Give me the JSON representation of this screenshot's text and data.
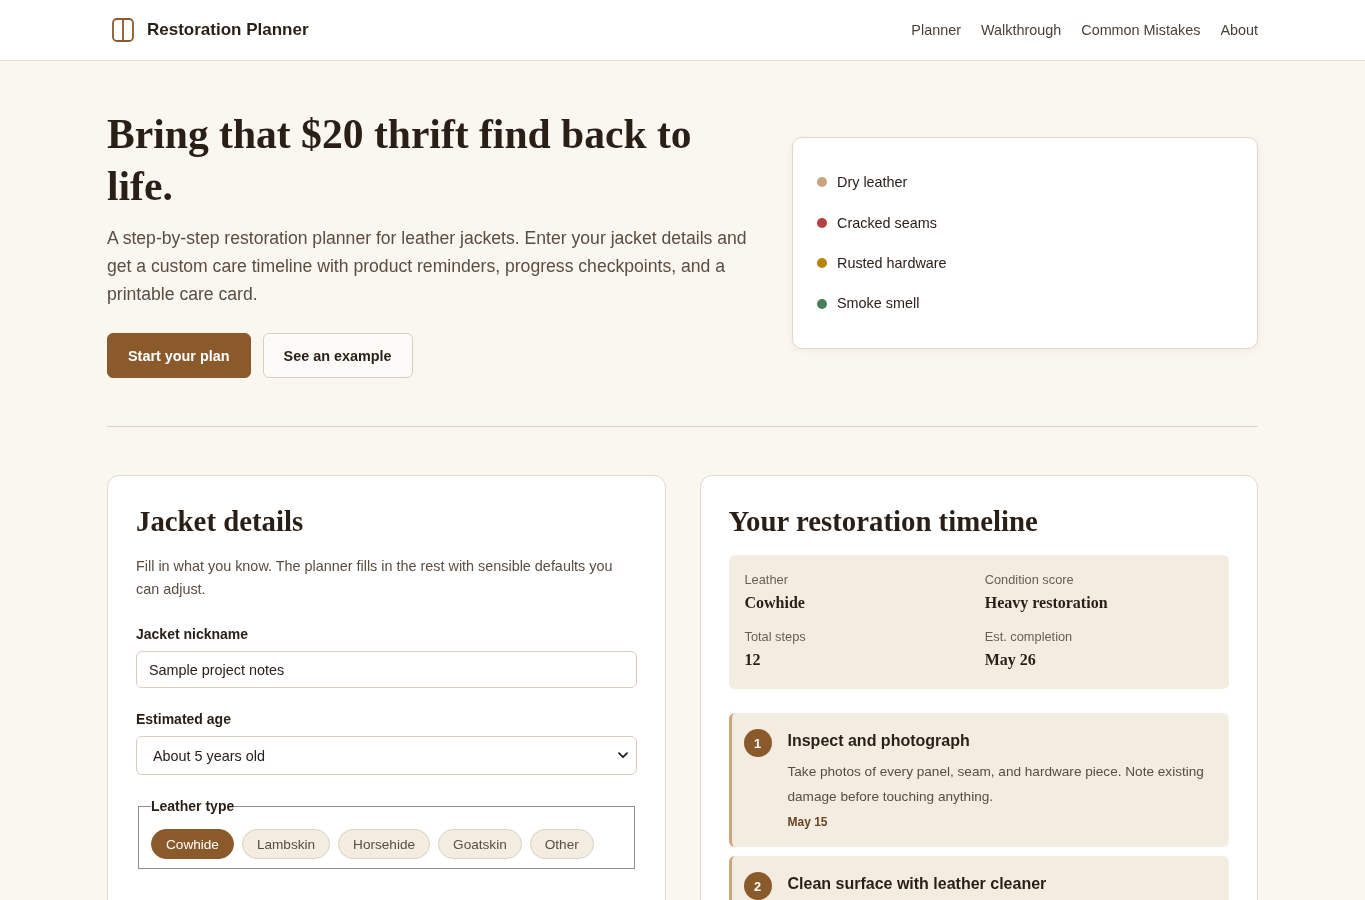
{
  "header": {
    "brand": "Restoration Planner",
    "nav": [
      {
        "label": "Planner"
      },
      {
        "label": "Walkthrough"
      },
      {
        "label": "Common Mistakes"
      },
      {
        "label": "About"
      }
    ]
  },
  "hero": {
    "title": "Bring that $20 thrift find back to life.",
    "description": "A step-by-step restoration planner for leather jackets. Enter your jacket details and get a custom care timeline with product reminders, progress checkpoints, and a printable care card.",
    "buttons": [
      {
        "label": "Start your plan",
        "kind": "primary"
      },
      {
        "label": "See an example",
        "kind": "secondary"
      }
    ],
    "issues": [
      {
        "label": "Dry leather",
        "color": "#c8a57f"
      },
      {
        "label": "Cracked seams",
        "color": "#b4423f"
      },
      {
        "label": "Rusted hardware",
        "color": "#b8860f"
      },
      {
        "label": "Smoke smell",
        "color": "#4a7d5e"
      }
    ]
  },
  "details": {
    "title": "Jacket details",
    "description": "Fill in what you know. The planner fills in the rest with sensible defaults you can adjust.",
    "fields": [
      {
        "kind": "text",
        "label": "Jacket nickname",
        "value": "Sample project notes"
      },
      {
        "kind": "select",
        "label": "Estimated age",
        "value": "About 5 years old"
      }
    ],
    "leather_type": {
      "legend": "Leather type",
      "options": [
        {
          "label": "Cowhide",
          "selected": true
        },
        {
          "label": "Lambskin",
          "selected": false
        },
        {
          "label": "Horsehide",
          "selected": false
        },
        {
          "label": "Goatskin",
          "selected": false
        },
        {
          "label": "Other",
          "selected": false
        }
      ]
    }
  },
  "timeline": {
    "title": "Your restoration timeline",
    "summary": [
      {
        "label": "Leather",
        "value": "Cowhide"
      },
      {
        "label": "Condition score",
        "value": "Heavy restoration"
      },
      {
        "label": "Total steps",
        "value": "12"
      },
      {
        "label": "Est. completion",
        "value": "May 26"
      }
    ],
    "steps": [
      {
        "number": "1",
        "title": "Inspect and photograph",
        "description": "Take photos of every panel, seam, and hardware piece. Note existing damage before touching anything.",
        "date": "May 15"
      },
      {
        "number": "2",
        "title": "Clean surface with leather cleaner"
      }
    ]
  }
}
